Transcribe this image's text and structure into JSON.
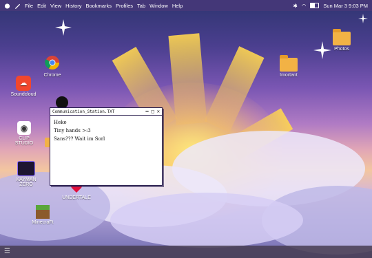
{
  "menubar": {
    "items": [
      "File",
      "Edit",
      "View",
      "History",
      "Bookmarks",
      "Profiles",
      "Tab",
      "Window",
      "Help"
    ],
    "datetime": "Sun Mar 3  9:03 PM"
  },
  "desktop_icons": {
    "chrome": "Chrome",
    "soundcloud": "Soundcloud",
    "clip_studio": "CLIP STUDIO",
    "kaiman_zero": "KAYMAN ZERO",
    "undertale": "UNDERTALE",
    "minecraft": "MinecraFt",
    "important": "Imortant",
    "photos": "Photos"
  },
  "window": {
    "title": "Communication_Station.TXT",
    "lines": [
      "Heke",
      "Tiny hands >:3",
      "Sans??? Wait im Sorl"
    ]
  },
  "colors": {
    "accent": "#4b3f8f",
    "folder": "#f2b245"
  }
}
